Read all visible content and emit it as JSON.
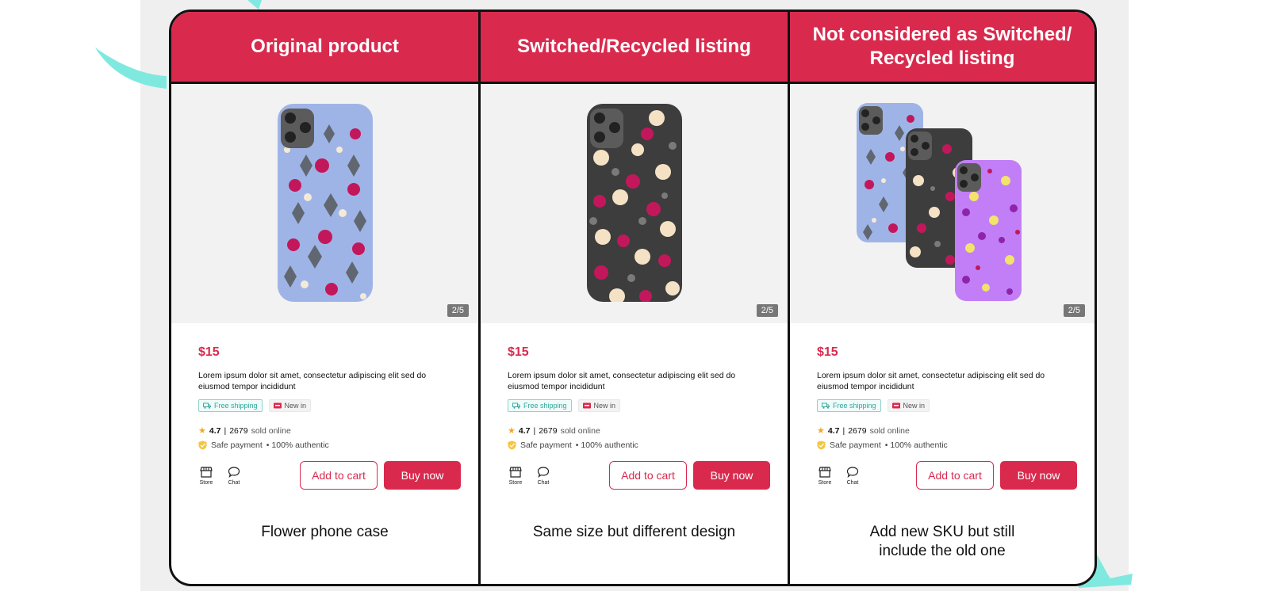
{
  "columns": [
    {
      "header": "Original product",
      "page_indicator": "2/5",
      "price": "$15",
      "description": "Lorem ipsum dolor sit amet, consectetur adipiscing elit sed do eiusmod tempor incididunt",
      "tag_shipping": "Free shipping",
      "tag_new": "New in",
      "rating": "4.7",
      "separator": "|",
      "sold_count": "2679",
      "sold_label": "sold online",
      "safe_payment": "Safe payment",
      "authentic": "• 100% authentic",
      "store_label": "Store",
      "chat_label": "Chat",
      "add_to_cart": "Add to cart",
      "buy_now": "Buy now",
      "caption": "Flower phone case"
    },
    {
      "header": "Switched/Recycled listing",
      "page_indicator": "2/5",
      "price": "$15",
      "description": "Lorem ipsum dolor sit amet, consectetur adipiscing elit sed do eiusmod tempor incididunt",
      "tag_shipping": "Free shipping",
      "tag_new": "New in",
      "rating": "4.7",
      "separator": "|",
      "sold_count": "2679",
      "sold_label": "sold online",
      "safe_payment": "Safe payment",
      "authentic": "• 100% authentic",
      "store_label": "Store",
      "chat_label": "Chat",
      "add_to_cart": "Add to cart",
      "buy_now": "Buy now",
      "caption": "Same size but different design"
    },
    {
      "header": "Not considered as Switched/\nRecycled listing",
      "page_indicator": "2/5",
      "price": "$15",
      "description": "Lorem ipsum dolor sit amet, consectetur adipiscing elit sed do eiusmod tempor incididunt",
      "tag_shipping": "Free shipping",
      "tag_new": "New in",
      "rating": "4.7",
      "separator": "|",
      "sold_count": "2679",
      "sold_label": "sold online",
      "safe_payment": "Safe payment",
      "authentic": "• 100% authentic",
      "store_label": "Store",
      "chat_label": "Chat",
      "add_to_cart": "Add to cart",
      "buy_now": "Buy now",
      "caption": "Add new SKU but still\ninclude the old one"
    }
  ],
  "colors": {
    "brand_red": "#d92a4e",
    "case_blue": "#9fb4e6",
    "case_dark": "#3d3d3d",
    "case_purple": "#c27ef7",
    "accent_teal": "#7fe9e0"
  },
  "icons": [
    "truck-icon",
    "new-in-icon",
    "star-icon",
    "shield-icon",
    "store-icon",
    "chat-icon"
  ]
}
